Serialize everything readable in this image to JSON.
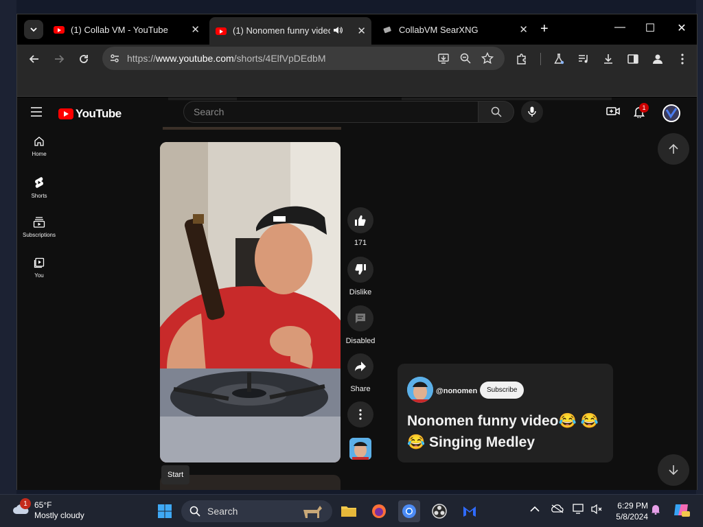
{
  "browser": {
    "tabs": [
      {
        "title": "(1) Collab VM - YouTube",
        "favicon": "youtube-icon",
        "active": false
      },
      {
        "title": "(1) Nonomen funny video😂",
        "favicon": "youtube-icon",
        "active": true
      },
      {
        "title": "CollabVM SearXNG",
        "favicon": "searxng-icon",
        "active": false
      }
    ],
    "url_prefix": "https://",
    "url_host": "www.youtube.com",
    "url_path": "/shorts/4ElfVpDEdbM",
    "colors": {
      "frame": "#000000",
      "toolbar": "#282828",
      "omnibox": "#3c3c3c"
    }
  },
  "youtube": {
    "logo_text": "YouTube",
    "search_placeholder": "Search",
    "notification_count": "1",
    "sidebar": [
      {
        "label": "Home",
        "icon": "home-icon"
      },
      {
        "label": "Shorts",
        "icon": "shorts-icon"
      },
      {
        "label": "Subscriptions",
        "icon": "subscriptions-icon"
      },
      {
        "label": "You",
        "icon": "you-icon"
      }
    ],
    "actions": {
      "like_count": "171",
      "dislike_label": "Dislike",
      "comments_label": "Disabled",
      "share_label": "Share"
    },
    "tooltip": "Start",
    "short": {
      "channel_handle": "@nonomen",
      "subscribe_label": "Subscribe",
      "title": "Nonomen funny video😂 😂 😂 Singing Medley"
    },
    "colors": {
      "background": "#0f0f0f",
      "brand_red": "#ff0000",
      "card": "#212121"
    }
  },
  "taskbar": {
    "weather_temp": "65°F",
    "weather_desc": "Mostly cloudy",
    "weather_badge": "1",
    "search_label": "Search",
    "time": "6:29 PM",
    "date": "5/8/2024"
  }
}
